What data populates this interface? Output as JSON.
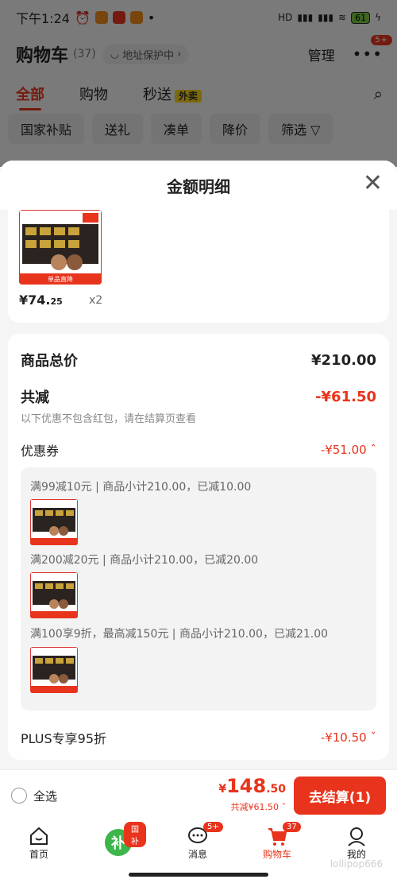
{
  "status": {
    "time": "下午1:24",
    "battery": "61",
    "signal_label": "HD"
  },
  "header": {
    "title": "购物车",
    "count": "(37)",
    "address_chip": "地址保护中",
    "manage": "管理",
    "more_badge": "5+"
  },
  "tabs": [
    {
      "label": "全部",
      "active": true
    },
    {
      "label": "购物"
    },
    {
      "label": "秒送",
      "tag": "外卖"
    }
  ],
  "filters": [
    "国家补贴",
    "送礼",
    "凑单",
    "降价",
    "筛选"
  ],
  "sheet": {
    "title": "金额明细",
    "product": {
      "price_main": "¥74.",
      "price_dec": "25",
      "qty": "x2",
      "thumb_label": "单品直降"
    },
    "total_label": "商品总价",
    "total_value": "¥210.00",
    "discount_label": "共减",
    "discount_value": "-¥61.50",
    "discount_note": "以下优惠不包含红包，请在结算页查看",
    "coupon_label": "优惠券",
    "coupon_value": "-¥51.00",
    "coupons": [
      "满99减10元 | 商品小计210.00，已减10.00",
      "满200减20元 | 商品小计210.00，已减20.00",
      "满100享9折，最高减150元 | 商品小计210.00，已减21.00"
    ],
    "plus_label": "PLUS专享95折",
    "plus_value": "-¥10.50"
  },
  "checkout": {
    "select_all": "全选",
    "yen": "¥",
    "price_int": "148",
    "price_dec": ".50",
    "discount_line": "共减¥61.50",
    "button": "去结算(1)"
  },
  "nav": [
    {
      "label": "首页"
    },
    {
      "label": "",
      "badge": "国补"
    },
    {
      "label": "消息",
      "badge": "5+"
    },
    {
      "label": "购物车",
      "badge": "37",
      "active": true
    },
    {
      "label": "我的"
    }
  ],
  "watermark": "lollipop666",
  "colors": {
    "accent": "#e8341c",
    "tag_yellow": "#f6d31a"
  }
}
